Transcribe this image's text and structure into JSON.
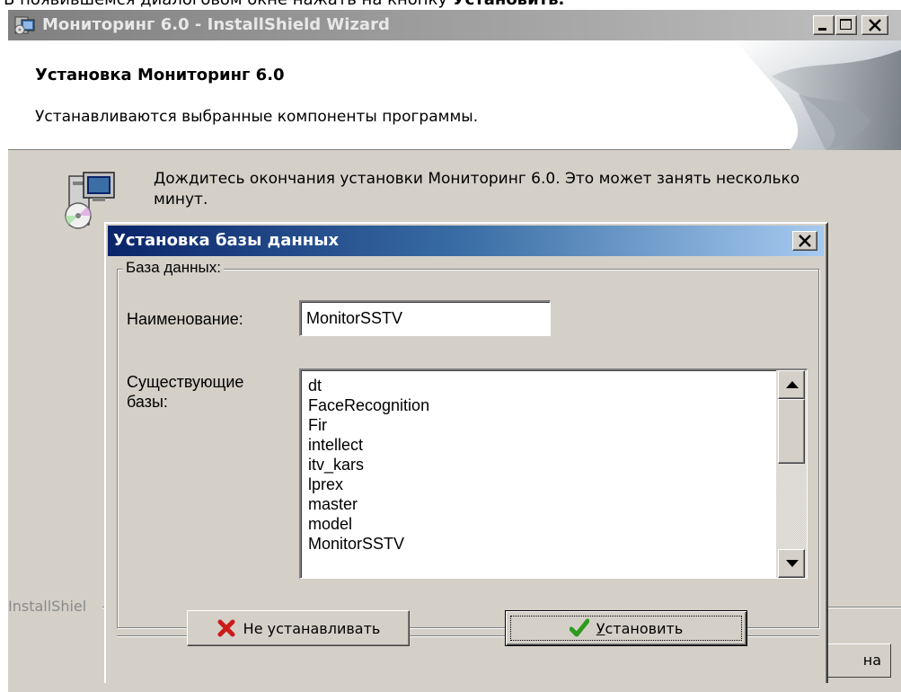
{
  "instruction": {
    "text": "В появившемся диалоговом окне нажать на кнопку ",
    "emphasis": "Установить."
  },
  "wizard": {
    "title": "Мониторинг 6.0 - InstallShield Wizard",
    "header_title": "Установка Мониторинг 6.0",
    "header_subtitle": "Устанавливаются выбранные компоненты программы.",
    "body_text": "Дождитесь окончания установки Мониторинг 6.0. Это может занять несколько минут.",
    "brand_label": "InstallShiel",
    "partial_button_label": "на"
  },
  "dialog": {
    "title": "Установка базы данных",
    "group_label": "База данных:",
    "name_label": "Наименование:",
    "name_value": "MonitorSSTV",
    "existing_label": "Существующие базы:",
    "existing_databases": [
      "dt",
      "FaceRecognition",
      "Fir",
      "intellect",
      "itv_kars",
      "lprex",
      "master",
      "model",
      "MonitorSSTV"
    ],
    "cancel_button": {
      "label": "Не устанавливать",
      "icon": "red-x-icon"
    },
    "install_button": {
      "accel": "У",
      "label_rest": "становить",
      "icon": "green-check-icon"
    }
  },
  "colors": {
    "dialog_titlebar_start": "#0a246a",
    "dialog_titlebar_end": "#a6caf0",
    "window_face": "#d4d0c8",
    "inactive_titlebar": "#808080",
    "cancel_icon_red": "#cc1a1a",
    "install_icon_green": "#2e9a1e"
  }
}
